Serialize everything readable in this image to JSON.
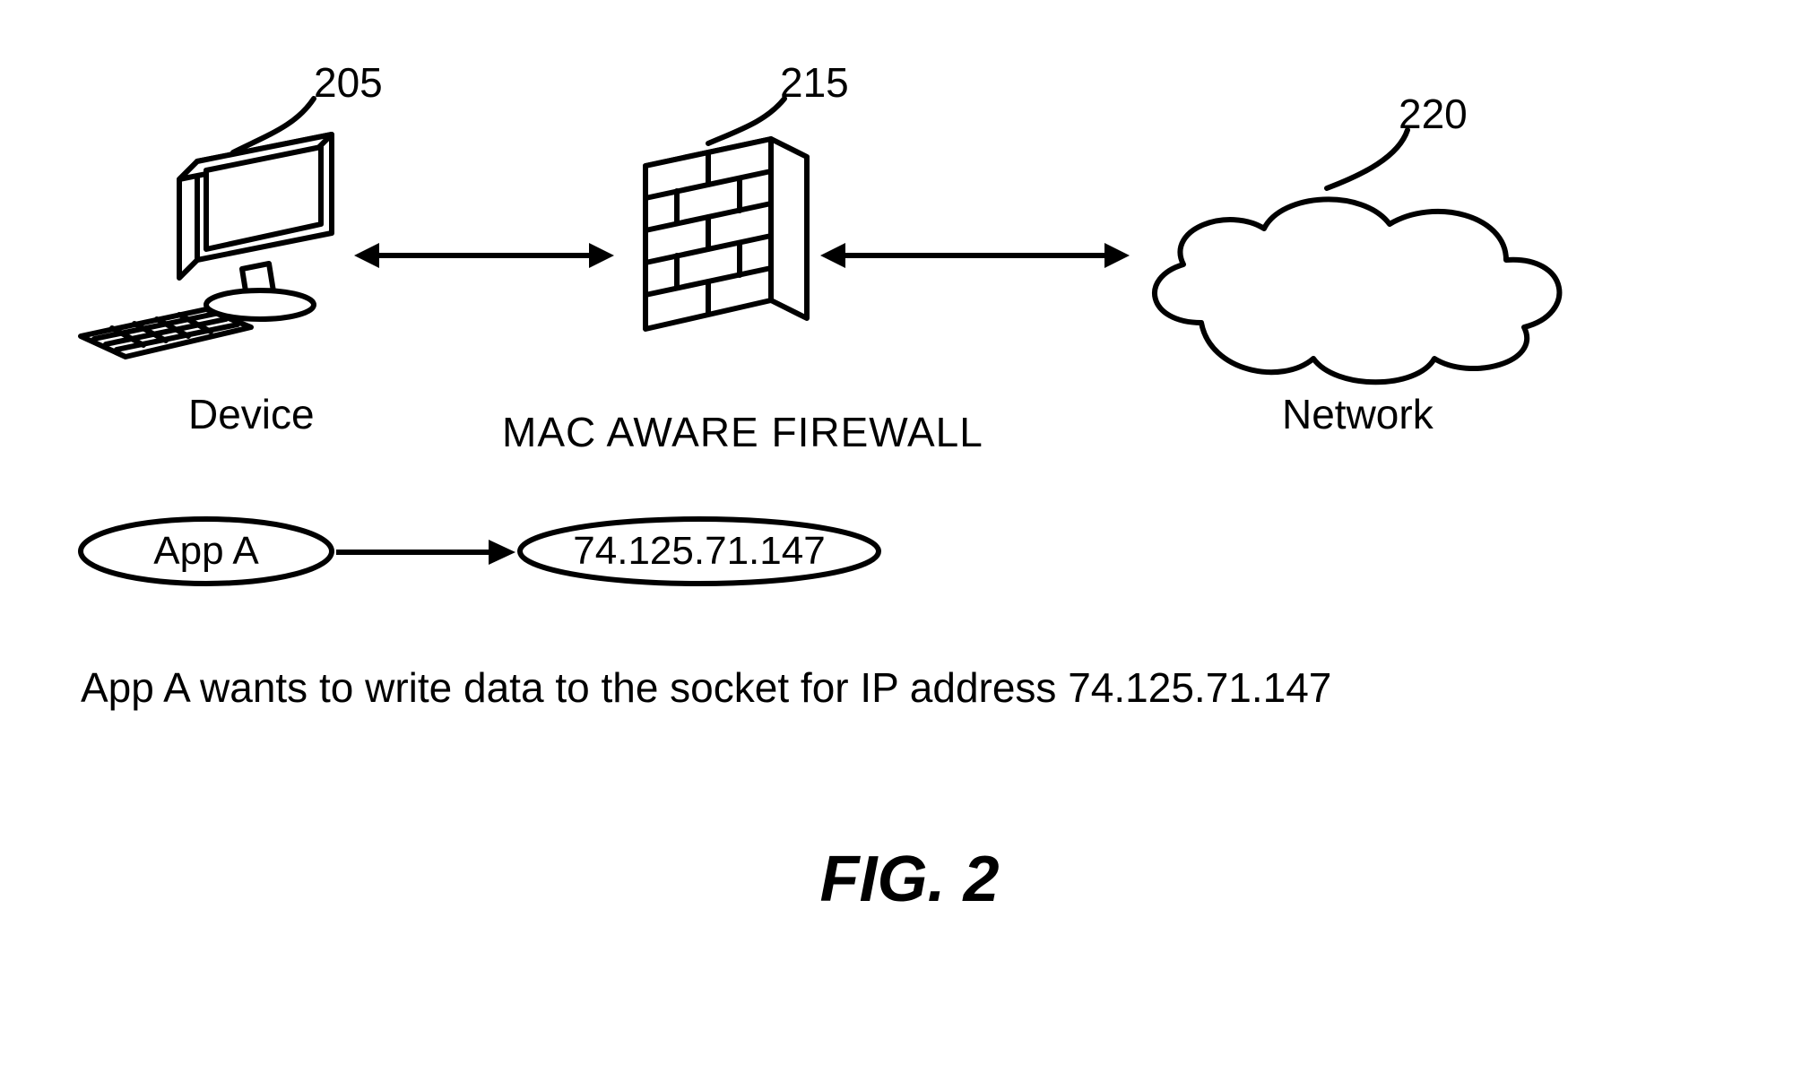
{
  "refs": {
    "device": "205",
    "firewall": "215",
    "network": "220"
  },
  "labels": {
    "device": "Device",
    "firewall": "MAC AWARE FIREWALL",
    "network": "Network"
  },
  "nodes": {
    "app": "App  A",
    "ip": "74.125.71.147"
  },
  "caption": "App A wants to write data to the socket for IP address 74.125.71.147",
  "figure_title": "FIG. 2"
}
